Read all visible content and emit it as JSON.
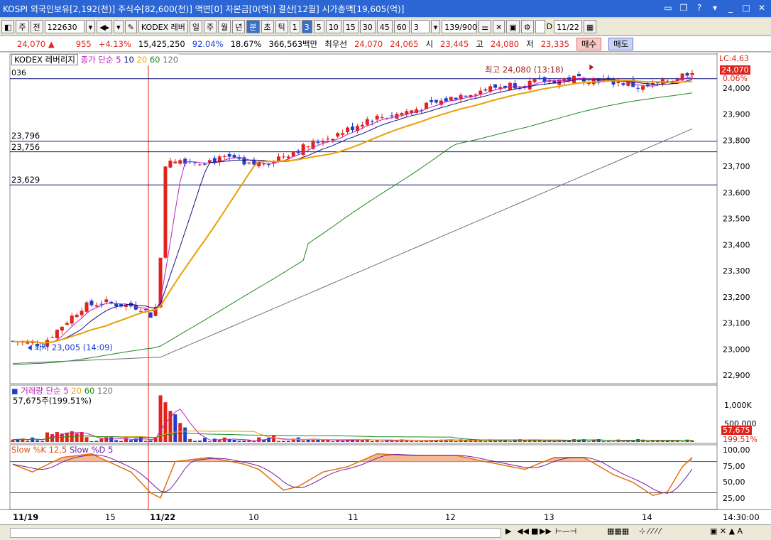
{
  "window": {
    "title": "KOSPI 외국인보유[2,192(천)] 주식수[82,600(천)] 액면[0] 자본금[0(억)] 결산[12월] 시가총액[19,605(억)]",
    "buttons": [
      "minimize-icon",
      "restore-icon",
      "help-icon",
      "menu-icon",
      "min-icon",
      "max-icon",
      "close-icon"
    ]
  },
  "toolbar": {
    "period_type": "주",
    "prev": "전",
    "code": "122630",
    "name": "KODEX 레버",
    "periods": [
      "일",
      "주",
      "월",
      "년",
      "분",
      "초",
      "틱"
    ],
    "active_period": "분",
    "intervals": [
      "1",
      "3",
      "5",
      "10",
      "15",
      "30",
      "45",
      "60"
    ],
    "active_interval": "3",
    "interval_input": "3",
    "count": "139/900",
    "checkbox_label": "D",
    "date": "11/22"
  },
  "quote": {
    "price": "24,070",
    "arrow": "▲",
    "change": "955",
    "change_pct": "+4.13%",
    "volume": "15,425,250",
    "vol_pct1": "92.04%",
    "vol_pct2": "18.67%",
    "amount": "366,563백만",
    "best_ask_label": "최우선",
    "best_ask": "24,070",
    "best_bid": "24,065",
    "open_label": "시",
    "open": "23,445",
    "high_label": "고",
    "high": "24,080",
    "low_label": "저",
    "low": "23,335",
    "buy": "매수",
    "sell": "매도"
  },
  "price_panel": {
    "legend_name": "KODEX 레버리지",
    "legend_ma": "종가 단순",
    "legend_periods": [
      "5",
      "10",
      "20",
      "60",
      "120"
    ],
    "left_value": "036",
    "high_label": "최고 24,080 (13:18)",
    "low_label": "최저 23,005 (14:09)",
    "lc_label": "LC:4,63",
    "current_tag": "24,070",
    "pct_tag": "0.06%",
    "hlines": [
      {
        "label": "23,796",
        "value": 23796
      },
      {
        "label": "23,756",
        "value": 23756
      },
      {
        "label": "23,629",
        "value": 23629
      }
    ],
    "ticks": [
      "24,000",
      "23,900",
      "23,800",
      "23,700",
      "23,600",
      "23,500",
      "23,400",
      "23,300",
      "23,200",
      "23,100",
      "23,000",
      "22,900"
    ]
  },
  "volume_panel": {
    "legend": "거래량 단순",
    "legend_periods": [
      "5",
      "20",
      "60",
      "120"
    ],
    "value": "57,675주(199.51%)",
    "ticks": [
      "1,000K",
      "500,000"
    ],
    "tag1": "57,675",
    "tag2": "199.51%"
  },
  "stoch_panel": {
    "legend_k": "Slow %K 12,5",
    "legend_d": "Slow %D 5",
    "ticks": [
      "100,00",
      "75,00",
      "50,00",
      "25,00"
    ]
  },
  "xaxis": {
    "labels": [
      "11/19",
      "15",
      "11/22",
      "10",
      "11",
      "12",
      "13",
      "14"
    ],
    "time": "14:30:00"
  },
  "colors": {
    "up": "#e0231b",
    "down": "#1b3fd0",
    "ma5": "#c020c0",
    "ma10": "#101080",
    "ma20": "#e8a000",
    "ma60": "#1a8a1a",
    "ma120": "#707070"
  }
}
